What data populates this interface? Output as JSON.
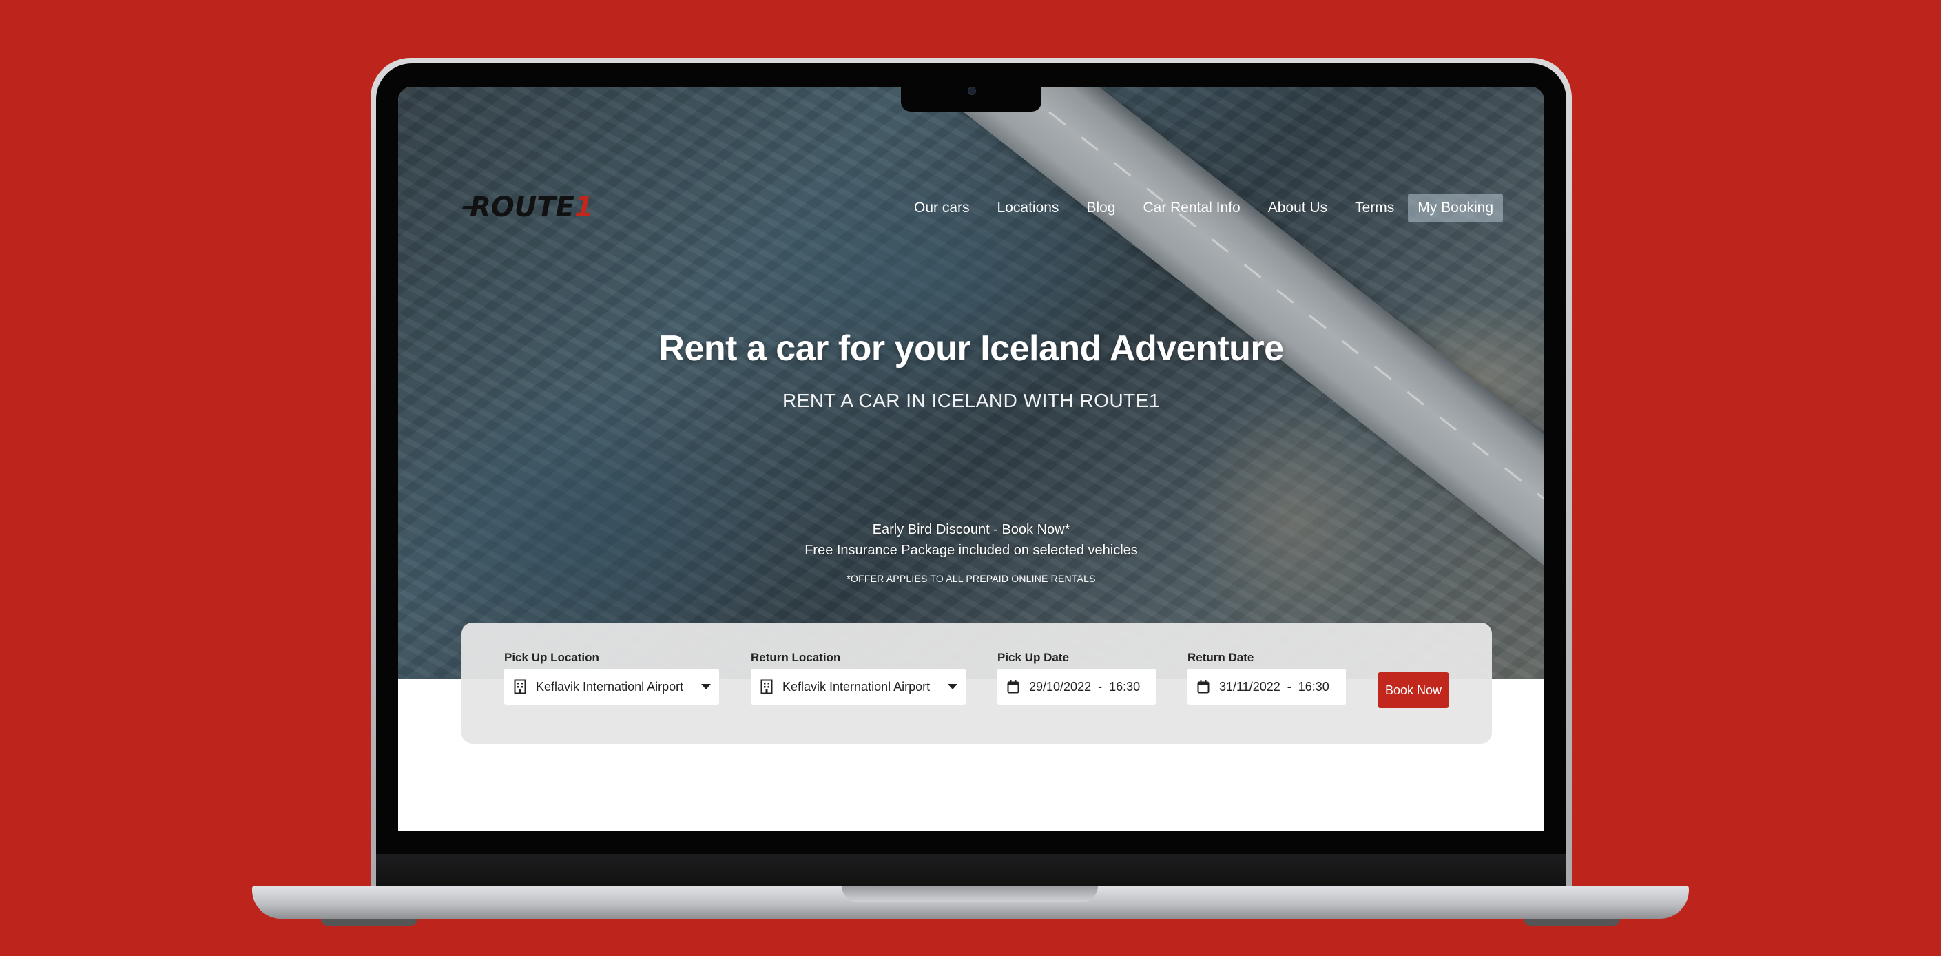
{
  "brand": {
    "logo_text": "ROUTE",
    "logo_digit": "1",
    "accent_color": "#c1271d",
    "background_color": "#bd241b"
  },
  "nav": {
    "items": [
      {
        "label": "Our cars"
      },
      {
        "label": "Locations"
      },
      {
        "label": "Blog"
      },
      {
        "label": "Car Rental Info"
      },
      {
        "label": "About Us"
      },
      {
        "label": "Terms"
      },
      {
        "label": "My Booking"
      }
    ]
  },
  "hero": {
    "headline": "Rent a car for your Iceland Adventure",
    "subheadline": "RENT A CAR IN ICELAND WITH ROUTE1",
    "promo_line1": "Early Bird Discount - Book Now*",
    "promo_line2": "Free Insurance Package included on selected vehicles",
    "promo_footnote": "*OFFER APPLIES TO ALL PREPAID ONLINE RENTALS"
  },
  "booking": {
    "pickup_location": {
      "label": "Pick Up Location",
      "value": "Keflavik Internationl Airport",
      "icon": "building-icon"
    },
    "return_location": {
      "label": "Return Location",
      "value": "Keflavik Internationl Airport",
      "icon": "building-icon"
    },
    "pickup_date": {
      "label": "Pick Up Date",
      "value": "29/10/2022  -  16:30",
      "icon": "calendar-icon"
    },
    "return_date": {
      "label": "Return Date",
      "value": "31/11/2022  -  16:30",
      "icon": "calendar-icon"
    },
    "submit_label": "Book Now"
  }
}
